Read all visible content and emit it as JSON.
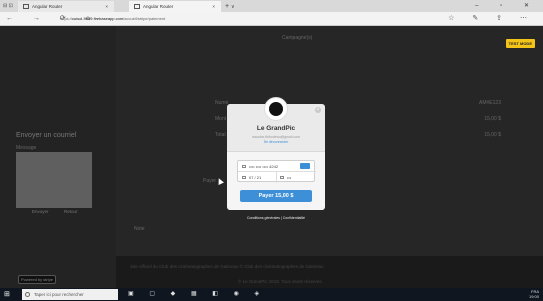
{
  "browser": {
    "tabs": [
      {
        "label": "Angular Router",
        "close": "×"
      },
      {
        "label": "Angular Router",
        "close": "×"
      }
    ],
    "new_tab": "+",
    "tab_menu": "∨",
    "window_controls": "– ▫ ✕",
    "nav_buttons": "← → ⟳ ⌂",
    "url_prefix": "https://",
    "url_host": "cuisol-9f6f9.firebaseapp.com",
    "url_path": "/accueil/stripe/paiement",
    "toolbar_icons": "☆ ✎ ⇪ ⋯"
  },
  "page": {
    "campagne_label": "Campagne(s)",
    "test_mode_badge": "TEST MODE",
    "rows": [
      {
        "label": "Numé",
        "value": "AM#E123"
      },
      {
        "label": "Mont",
        "value": "15,00 $"
      },
      {
        "label": "Total",
        "value": "15,00 $"
      }
    ],
    "payer_label": "Payer",
    "note_label": "Note",
    "email_heading": "Envoyer un courriel",
    "message_label": "Message",
    "send_button": "Envoyer",
    "back_button": "Retour",
    "footer_line1": "Site officiel du Club des cinématographes de Gatineau © Club des cinématographes de Gatineau",
    "footer_line2": "© Le GrandPic 2018. Tous droits réservés.",
    "powered_by": "Powered by stripe"
  },
  "checkout": {
    "merchant_name": "Le GrandPic",
    "user_email": "maurice.thibodeau@gmail.com",
    "disconnect_link": "Se déconnecter",
    "card_number": "•••• •••• •••• 4242",
    "card_expiry": "07 / 21",
    "card_cvc": "•••",
    "pay_button": "Payer 15,00 $",
    "footer_links": "Conditions générales  |  Confidentialité",
    "close_symbol": "×"
  },
  "taskbar": {
    "search_placeholder": "Taper ici pour rechercher",
    "start_icon": "⊞",
    "app_icons": "▣ ▢ ◆ ▦ ◧ ◉ ◈",
    "tray_time": "19:00",
    "tray_lang": "FRA"
  }
}
